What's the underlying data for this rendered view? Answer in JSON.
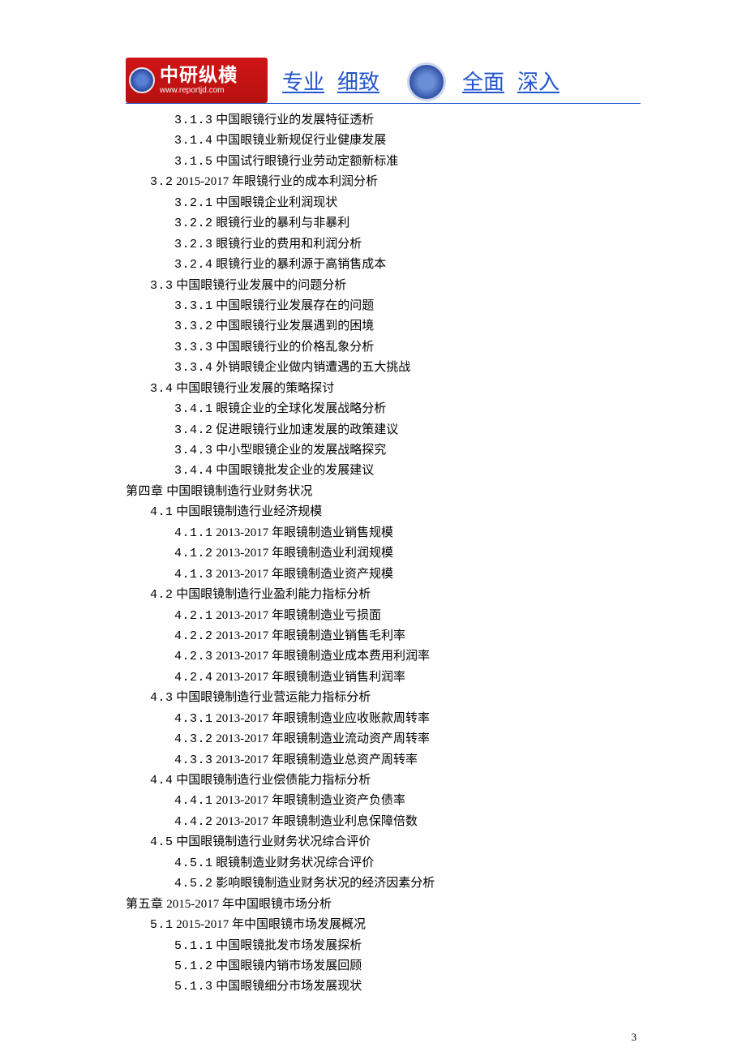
{
  "header": {
    "logo_cn": "中研纵横",
    "logo_url": "www.reportjd.com",
    "words": [
      "专业",
      "细致",
      "全面",
      "深入"
    ]
  },
  "toc": [
    {
      "level": 3,
      "num": "3.1.3",
      "title": "中国眼镜行业的发展特征透析"
    },
    {
      "level": 3,
      "num": "3.1.4",
      "title": "中国眼镜业新规促行业健康发展"
    },
    {
      "level": 3,
      "num": "3.1.5",
      "title": "中国试行眼镜行业劳动定额新标准"
    },
    {
      "level": 2,
      "num": "3.2",
      "title": "2015-2017 年眼镜行业的成本利润分析"
    },
    {
      "level": 3,
      "num": "3.2.1",
      "title": "中国眼镜企业利润现状"
    },
    {
      "level": 3,
      "num": "3.2.2",
      "title": "眼镜行业的暴利与非暴利"
    },
    {
      "level": 3,
      "num": "3.2.3",
      "title": "眼镜行业的费用和利润分析"
    },
    {
      "level": 3,
      "num": "3.2.4",
      "title": "眼镜行业的暴利源于高销售成本"
    },
    {
      "level": 2,
      "num": "3.3",
      "title": "中国眼镜行业发展中的问题分析"
    },
    {
      "level": 3,
      "num": "3.3.1",
      "title": "中国眼镜行业发展存在的问题"
    },
    {
      "level": 3,
      "num": "3.3.2",
      "title": "中国眼镜行业发展遇到的困境"
    },
    {
      "level": 3,
      "num": "3.3.3",
      "title": "中国眼镜行业的价格乱象分析"
    },
    {
      "level": 3,
      "num": "3.3.4",
      "title": "外销眼镜企业做内销遭遇的五大挑战"
    },
    {
      "level": 2,
      "num": "3.4",
      "title": "中国眼镜行业发展的策略探讨"
    },
    {
      "level": 3,
      "num": "3.4.1",
      "title": "眼镜企业的全球化发展战略分析"
    },
    {
      "level": 3,
      "num": "3.4.2",
      "title": "促进眼镜行业加速发展的政策建议"
    },
    {
      "level": 3,
      "num": "3.4.3",
      "title": "中小型眼镜企业的发展战略探究"
    },
    {
      "level": 3,
      "num": "3.4.4",
      "title": "中国眼镜批发企业的发展建议"
    },
    {
      "level": 1,
      "num": "第四章",
      "title": "中国眼镜制造行业财务状况"
    },
    {
      "level": 2,
      "num": "4.1",
      "title": "中国眼镜制造行业经济规模"
    },
    {
      "level": 3,
      "num": "4.1.1",
      "title": "2013-2017 年眼镜制造业销售规模"
    },
    {
      "level": 3,
      "num": "4.1.2",
      "title": "2013-2017 年眼镜制造业利润规模"
    },
    {
      "level": 3,
      "num": "4.1.3",
      "title": "2013-2017 年眼镜制造业资产规模"
    },
    {
      "level": 2,
      "num": "4.2",
      "title": "中国眼镜制造行业盈利能力指标分析"
    },
    {
      "level": 3,
      "num": "4.2.1",
      "title": "2013-2017 年眼镜制造业亏损面"
    },
    {
      "level": 3,
      "num": "4.2.2",
      "title": "2013-2017 年眼镜制造业销售毛利率"
    },
    {
      "level": 3,
      "num": "4.2.3",
      "title": "2013-2017 年眼镜制造业成本费用利润率"
    },
    {
      "level": 3,
      "num": "4.2.4",
      "title": "2013-2017 年眼镜制造业销售利润率"
    },
    {
      "level": 2,
      "num": "4.3",
      "title": "中国眼镜制造行业营运能力指标分析"
    },
    {
      "level": 3,
      "num": "4.3.1",
      "title": "2013-2017 年眼镜制造业应收账款周转率"
    },
    {
      "level": 3,
      "num": "4.3.2",
      "title": "2013-2017 年眼镜制造业流动资产周转率"
    },
    {
      "level": 3,
      "num": "4.3.3",
      "title": "2013-2017 年眼镜制造业总资产周转率"
    },
    {
      "level": 2,
      "num": "4.4",
      "title": "中国眼镜制造行业偿债能力指标分析"
    },
    {
      "level": 3,
      "num": "4.4.1",
      "title": "2013-2017 年眼镜制造业资产负债率"
    },
    {
      "level": 3,
      "num": "4.4.2",
      "title": "2013-2017 年眼镜制造业利息保障倍数"
    },
    {
      "level": 2,
      "num": "4.5",
      "title": "中国眼镜制造行业财务状况综合评价"
    },
    {
      "level": 3,
      "num": "4.5.1",
      "title": "眼镜制造业财务状况综合评价"
    },
    {
      "level": 3,
      "num": "4.5.2",
      "title": "影响眼镜制造业财务状况的经济因素分析"
    },
    {
      "level": 1,
      "num": "第五章",
      "title": "2015-2017 年中国眼镜市场分析"
    },
    {
      "level": 2,
      "num": "5.1",
      "title": "2015-2017 年中国眼镜市场发展概况"
    },
    {
      "level": 3,
      "num": "5.1.1",
      "title": "中国眼镜批发市场发展探析"
    },
    {
      "level": 3,
      "num": "5.1.2",
      "title": "中国眼镜内销市场发展回顾"
    },
    {
      "level": 3,
      "num": "5.1.3",
      "title": "中国眼镜细分市场发展现状"
    }
  ],
  "page_number": "3"
}
